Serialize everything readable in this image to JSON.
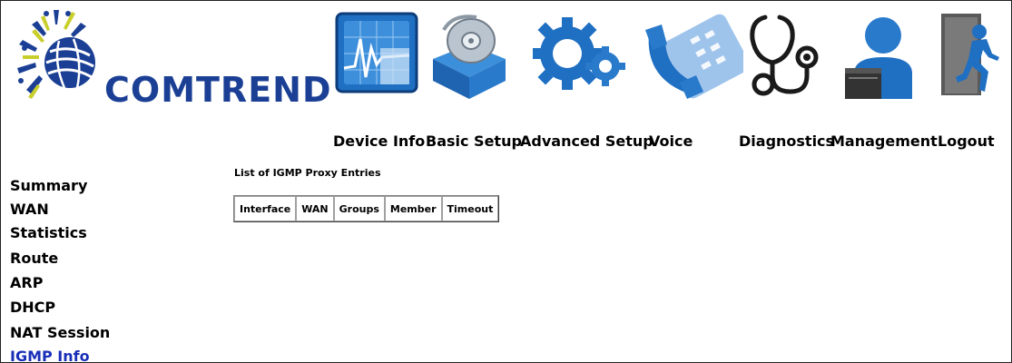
{
  "brand": {
    "name": "COMTREND",
    "color": "#1a3f94"
  },
  "nav": {
    "items": [
      {
        "label": "Device Info",
        "icon": "device-info-icon"
      },
      {
        "label": "Basic Setup",
        "icon": "basic-setup-icon"
      },
      {
        "label": "Advanced Setup",
        "icon": "advanced-setup-icon"
      },
      {
        "label": "Voice",
        "icon": "voice-icon"
      },
      {
        "label": "Diagnostics",
        "icon": "diagnostics-icon"
      },
      {
        "label": "Management",
        "icon": "management-icon"
      },
      {
        "label": "Logout",
        "icon": "logout-icon"
      }
    ]
  },
  "sidebar": {
    "items": [
      {
        "label": "Summary"
      },
      {
        "label": "WAN"
      },
      {
        "label": "Statistics"
      },
      {
        "label": "Route"
      },
      {
        "label": "ARP"
      },
      {
        "label": "DHCP"
      },
      {
        "label": "NAT Session"
      },
      {
        "label": "IGMP Info",
        "active": true
      }
    ],
    "active_color": "#1a2fb8"
  },
  "main": {
    "title": "List of IGMP Proxy Entries",
    "table": {
      "columns": [
        "Interface",
        "WAN",
        "Groups",
        "Member",
        "Timeout"
      ],
      "rows": []
    }
  }
}
